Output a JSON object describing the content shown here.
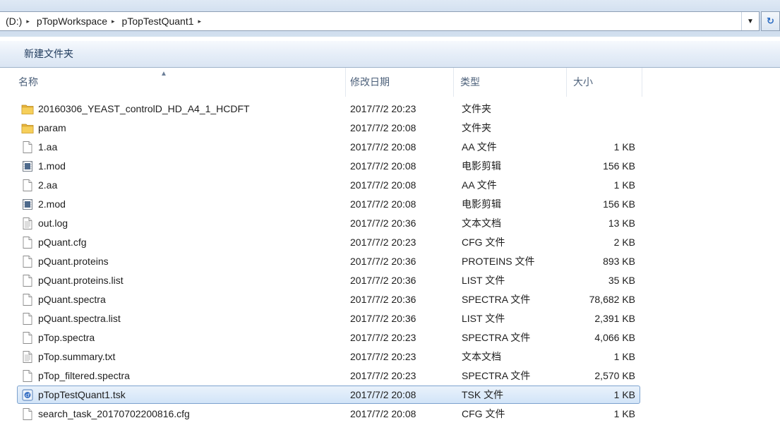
{
  "address_bar": {
    "crumbs": [
      "(D:)",
      "pTopWorkspace",
      "pTopTestQuant1"
    ],
    "separator": "▸",
    "dropdown_glyph": "▼",
    "refresh_glyph": "↻"
  },
  "toolbar": {
    "new_folder_label": "新建文件夹"
  },
  "columns": {
    "name": "名称",
    "modified": "修改日期",
    "type": "类型",
    "size": "大小",
    "sort_glyph": "▲"
  },
  "files": [
    {
      "name": "20160306_YEAST_controlD_HD_A4_1_HCDFT",
      "modified": "2017/7/2 20:23",
      "type": "文件夹",
      "size": "",
      "icon": "folder-icon"
    },
    {
      "name": "param",
      "modified": "2017/7/2 20:08",
      "type": "文件夹",
      "size": "",
      "icon": "folder-icon"
    },
    {
      "name": "1.aa",
      "modified": "2017/7/2 20:08",
      "type": "AA 文件",
      "size": "1 KB",
      "icon": "blank-file-icon"
    },
    {
      "name": "1.mod",
      "modified": "2017/7/2 20:08",
      "type": "电影剪辑",
      "size": "156 KB",
      "icon": "movie-file-icon"
    },
    {
      "name": "2.aa",
      "modified": "2017/7/2 20:08",
      "type": "AA 文件",
      "size": "1 KB",
      "icon": "blank-file-icon"
    },
    {
      "name": "2.mod",
      "modified": "2017/7/2 20:08",
      "type": "电影剪辑",
      "size": "156 KB",
      "icon": "movie-file-icon"
    },
    {
      "name": "out.log",
      "modified": "2017/7/2 20:36",
      "type": "文本文档",
      "size": "13 KB",
      "icon": "text-file-icon"
    },
    {
      "name": "pQuant.cfg",
      "modified": "2017/7/2 20:23",
      "type": "CFG 文件",
      "size": "2 KB",
      "icon": "blank-file-icon"
    },
    {
      "name": "pQuant.proteins",
      "modified": "2017/7/2 20:36",
      "type": "PROTEINS 文件",
      "size": "893 KB",
      "icon": "blank-file-icon"
    },
    {
      "name": "pQuant.proteins.list",
      "modified": "2017/7/2 20:36",
      "type": "LIST 文件",
      "size": "35 KB",
      "icon": "blank-file-icon"
    },
    {
      "name": "pQuant.spectra",
      "modified": "2017/7/2 20:36",
      "type": "SPECTRA 文件",
      "size": "78,682 KB",
      "icon": "blank-file-icon"
    },
    {
      "name": "pQuant.spectra.list",
      "modified": "2017/7/2 20:36",
      "type": "LIST 文件",
      "size": "2,391 KB",
      "icon": "blank-file-icon"
    },
    {
      "name": "pTop.spectra",
      "modified": "2017/7/2 20:23",
      "type": "SPECTRA 文件",
      "size": "4,066 KB",
      "icon": "blank-file-icon"
    },
    {
      "name": "pTop.summary.txt",
      "modified": "2017/7/2 20:23",
      "type": "文本文档",
      "size": "1 KB",
      "icon": "text-file-icon"
    },
    {
      "name": "pTop_filtered.spectra",
      "modified": "2017/7/2 20:23",
      "type": "SPECTRA 文件",
      "size": "2,570 KB",
      "icon": "blank-file-icon"
    },
    {
      "name": "pTopTestQuant1.tsk",
      "modified": "2017/7/2 20:08",
      "type": "TSK 文件",
      "size": "1 KB",
      "icon": "tsk-file-icon",
      "selected": true
    },
    {
      "name": "search_task_20170702200816.cfg",
      "modified": "2017/7/2 20:08",
      "type": "CFG 文件",
      "size": "1 KB",
      "icon": "blank-file-icon"
    }
  ]
}
